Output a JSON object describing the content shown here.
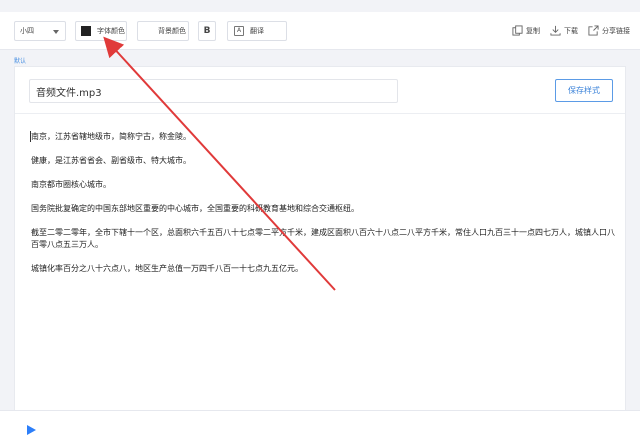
{
  "toolbar": {
    "font_size_value": "小四",
    "font_color_label": "字体颜色",
    "font_color_swatch": "#222222",
    "bg_color_label": "背景颜色",
    "bold_label": "B",
    "translate_label": "翻译",
    "translate_icon_text": "A",
    "copy_label": "复制",
    "download_label": "下载",
    "share_label": "分享链接"
  },
  "style_label": "默认",
  "editor": {
    "filename": "音频文件.mp3",
    "save_style_label": "保存样式",
    "paragraphs": [
      "南京，江苏省辖地级市，简称宁古，称金陵。",
      "健康，是江苏省省会、副省级市、特大城市。",
      "南京都市圈核心城市。",
      "国务院批复确定的中国东部地区重要的中心城市，全国重要的科研教育基地和综合交通枢纽。",
      "截至二零二零年，全市下辖十一个区，总面积六千五百八十七点零二平方千米，建成区面积八百六十八点二八平方千米，常住人口九百三十一点四七万人，城镇人口八百零八点五三万人。",
      "城镇化率百分之八十六点八，地区生产总值一万四千八百一十七点九五亿元。"
    ]
  },
  "colors": {
    "accent": "#3a82d9",
    "annotation_arrow": "#e03a3a",
    "play": "#2d7ff9"
  }
}
